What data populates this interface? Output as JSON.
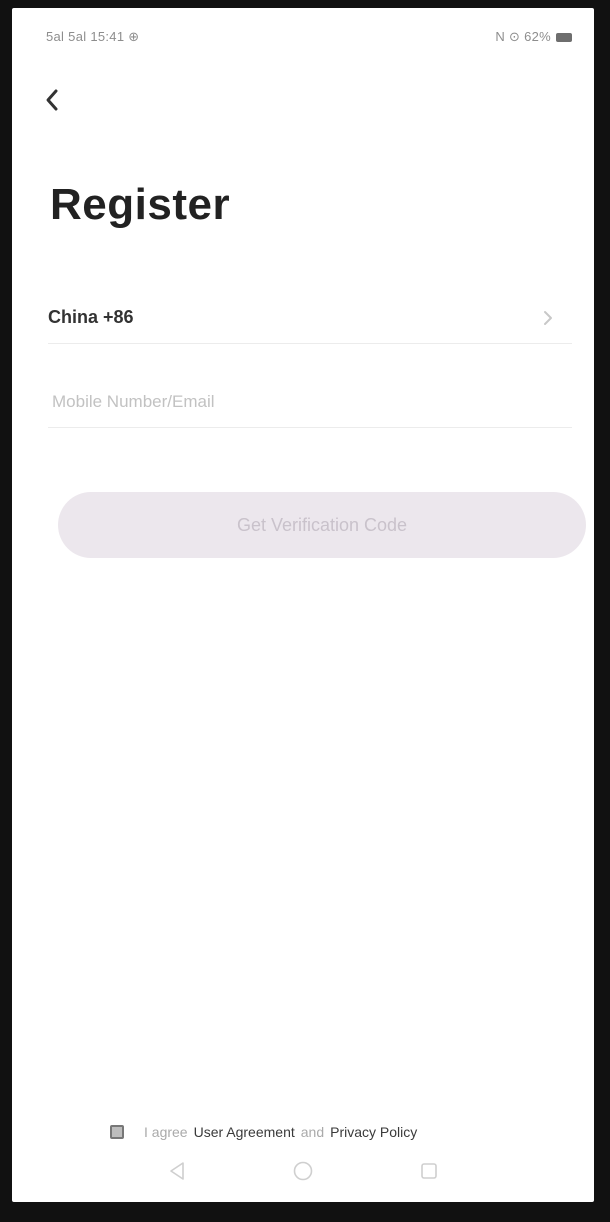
{
  "status_bar": {
    "left_text": "5al 5al 15:41 ⊕",
    "right_text": "N ⊙ 62%"
  },
  "header": {
    "back_icon": "chevron-left-icon"
  },
  "page": {
    "title": "Register"
  },
  "country": {
    "value": "China +86",
    "chevron_icon": "chevron-right-icon"
  },
  "account_input": {
    "value": "",
    "placeholder": "Mobile Number/Email"
  },
  "primary_button": {
    "label": "Get Verification Code",
    "enabled": false
  },
  "agreement": {
    "checked": false,
    "prefix": "I agree",
    "user_agreement": "User Agreement",
    "connector": "and",
    "privacy_policy": "Privacy Policy"
  },
  "nav_bar": {
    "back_icon": "triangle-back-icon",
    "home_icon": "circle-home-icon",
    "recents_icon": "square-recents-icon"
  },
  "colors": {
    "title": "#222222",
    "button_bg_disabled": "#ece7ed",
    "button_text_disabled": "#c9c2cb",
    "placeholder": "#c2c2c2",
    "divider": "#ececec"
  }
}
